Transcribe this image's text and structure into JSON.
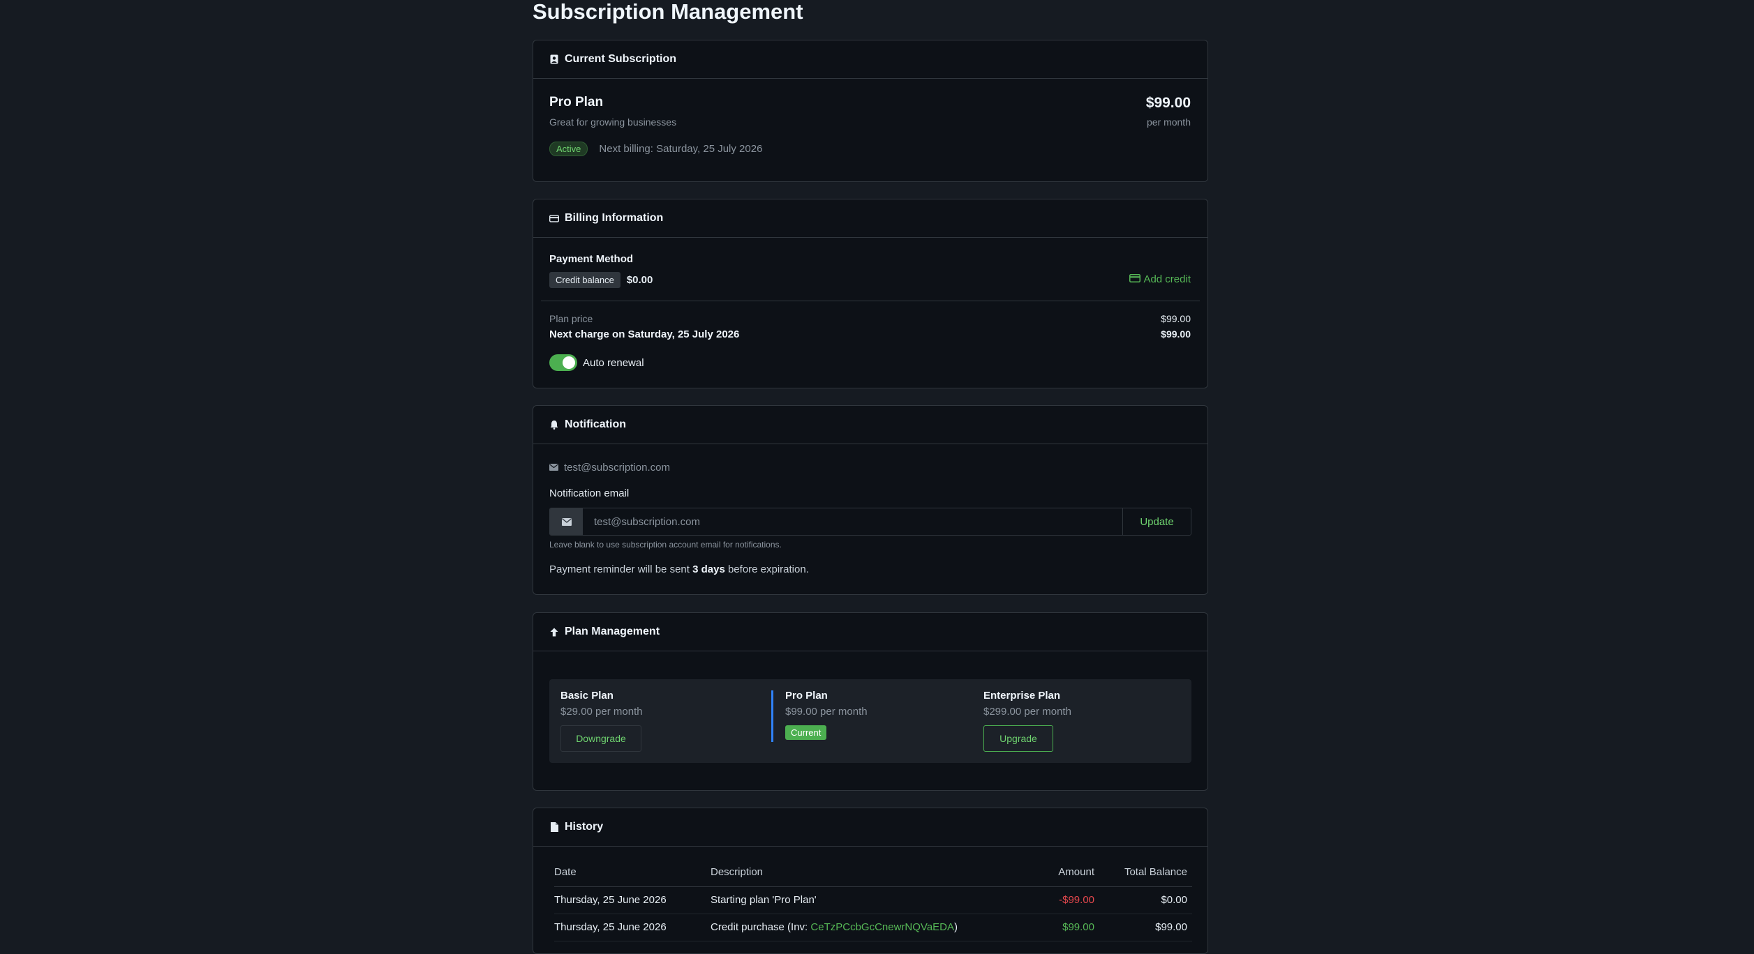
{
  "page": {
    "title": "Subscription Management"
  },
  "current": {
    "header": "Current Subscription",
    "plan_name": "Pro Plan",
    "plan_desc": "Great for growing businesses",
    "price": "$99.00",
    "period": "per month",
    "status": "Active",
    "next_billing": "Next billing: Saturday, 25 July 2026"
  },
  "billing": {
    "header": "Billing Information",
    "payment_method_label": "Payment Method",
    "credit_chip": "Credit balance",
    "credit_value": "$0.00",
    "add_credit": "Add credit",
    "plan_price_label": "Plan price",
    "plan_price_value": "$99.00",
    "next_charge_label": "Next charge on Saturday, 25 July 2026",
    "next_charge_value": "$99.00",
    "auto_renewal": "Auto renewal",
    "auto_renewal_on": true
  },
  "notification": {
    "header": "Notification",
    "current_email": "test@subscription.com",
    "email_label": "Notification email",
    "email_value": "test@subscription.com",
    "update_button": "Update",
    "help_text": "Leave blank to use subscription account email for notifications.",
    "reminder_prefix": "Payment reminder will be sent ",
    "reminder_days": "3 days",
    "reminder_suffix": " before expiration."
  },
  "plans": {
    "header": "Plan Management",
    "items": [
      {
        "name": "Basic Plan",
        "price": "$29.00 per month",
        "action": "Downgrade"
      },
      {
        "name": "Pro Plan",
        "price": "$99.00 per month",
        "action": "Current"
      },
      {
        "name": "Enterprise Plan",
        "price": "$299.00 per month",
        "action": "Upgrade"
      }
    ]
  },
  "history": {
    "header": "History",
    "columns": [
      "Date",
      "Description",
      "Amount",
      "Total Balance"
    ],
    "rows": [
      {
        "date": "Thursday, 25 June 2026",
        "desc": "Starting plan 'Pro Plan'",
        "amount": "-$99.00",
        "balance": "$0.00"
      },
      {
        "date": "Thursday, 25 June 2026",
        "desc_prefix": "Credit purchase (Inv: ",
        "desc_link": "CeTzPCcbGcCnewrNQVaEDA",
        "desc_suffix": ")",
        "amount": "$99.00",
        "balance": "$99.00"
      }
    ]
  },
  "colors": {
    "accent": "#4caf50",
    "negative": "#e5484d",
    "background": "#161b22",
    "card": "#0d1117"
  },
  "icons": [
    "user-card-icon",
    "credit-card-icon",
    "bell-icon",
    "envelope-icon",
    "arrow-up-icon",
    "file-icon"
  ]
}
